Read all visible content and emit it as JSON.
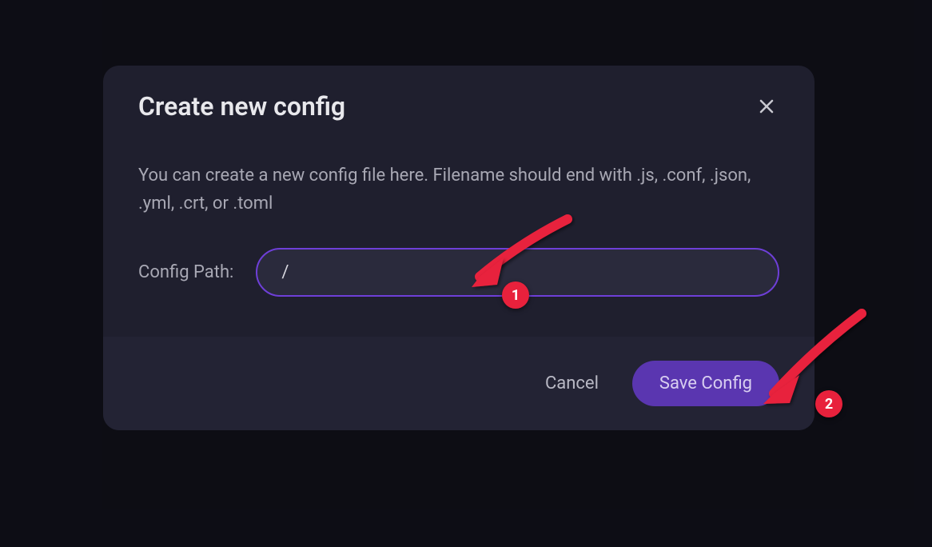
{
  "modal": {
    "title": "Create new config",
    "description": "You can create a new config file here. Filename should end with .js, .conf, .json, .yml, .crt, or .toml",
    "field_label": "Config Path:",
    "field_value": "/",
    "cancel_label": "Cancel",
    "save_label": "Save Config"
  },
  "annotations": {
    "badge1": "1",
    "badge2": "2"
  }
}
